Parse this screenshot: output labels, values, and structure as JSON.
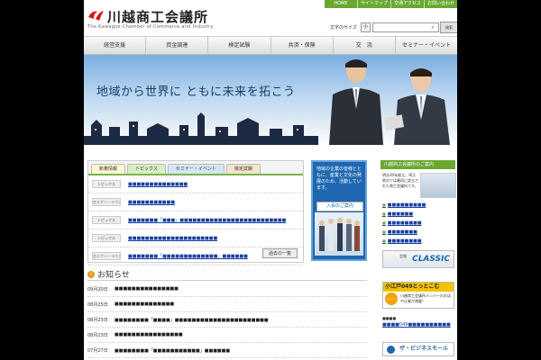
{
  "header": {
    "logo_text": "川越商工会議所",
    "logo_sub": "The Kawagoe Chamber of Commerce and Industry",
    "util_nav": [
      "HOME",
      "サイトマップ",
      "交通アクセス",
      "お問い合わせ"
    ],
    "font_size_label": "文字のサイズ",
    "font_sizes": [
      "小",
      "中",
      "大"
    ],
    "search_placeholder": "",
    "search_button": "検索"
  },
  "global_nav": [
    "経営支援",
    "資金調達",
    "検定試験",
    "共済・保険",
    "交　流",
    "セミナー・イベント"
  ],
  "hero": {
    "slogan": "地域から世界に ともに未来を拓こう"
  },
  "news_tabs": {
    "tabs": [
      "新着情報",
      "トピックス",
      "セミナー・イベント",
      "検定試験"
    ],
    "items": [
      {
        "category": "トピックス",
        "title": "■■■■■■■■■■■■■■"
      },
      {
        "category": "セミナー・イベント",
        "title": "■■■■■■■■■■■"
      },
      {
        "category": "トピックス",
        "title": "■■■■■■■「■■■」■■■■■■■■■■■■■■■■■■■■■■■■■"
      },
      {
        "category": "トピックス",
        "title": "■■■■■■■■■■■■■■■■■■■■■"
      },
      {
        "category": "セミナー・イベント",
        "title": "■■■■■■■「■■■■■■■■■■■■■」■■■■■■"
      }
    ],
    "list_button": "過去の一覧"
  },
  "promo": {
    "text": "地域の企業の皆様とともに、産業と文化の発展のため、活動しています。",
    "button": "入会のご案内"
  },
  "sidebar": {
    "heading": "川越商工会議所のご案内",
    "intro": "明治30年創立。埼玉県内では最初に設立された商工会議所です。",
    "links": [
      "■■■■■■■■■",
      "■■■■■■",
      "■■■■■■■■",
      "■■■■■■■",
      "■■■■■■■■"
    ],
    "banner1_small": "会報",
    "banner1_title": "CLASSIC",
    "banner2_title": "小江戸049とっとこむ",
    "banner2_circle": "とっとこむ",
    "banner2_text": "川越商工会議所メンバーのお店や企業が満載！",
    "caption": "■■■■",
    "caption_link": "■■■■049■■■■■■■■■■",
    "banner3": "ザ・ビジネスモール"
  },
  "oshirase": {
    "title": "お知らせ",
    "items": [
      {
        "date": "09月20日",
        "text": "■■■■■■■■■■■■■■■"
      },
      {
        "date": "08月25日",
        "text": "■■■■■■■■■■■■■■"
      },
      {
        "date": "08月23日",
        "text": "■■■■■■■■「■■■■」■■■■■■■■■■■■■■■■■■■■■■"
      },
      {
        "date": "08月23日",
        "text": "■■■■■■■■■■■■■■■■"
      },
      {
        "date": "07月27日",
        "text": "■■■■■■■■「■■■■■■■■■■■」■■■■■■"
      }
    ]
  }
}
